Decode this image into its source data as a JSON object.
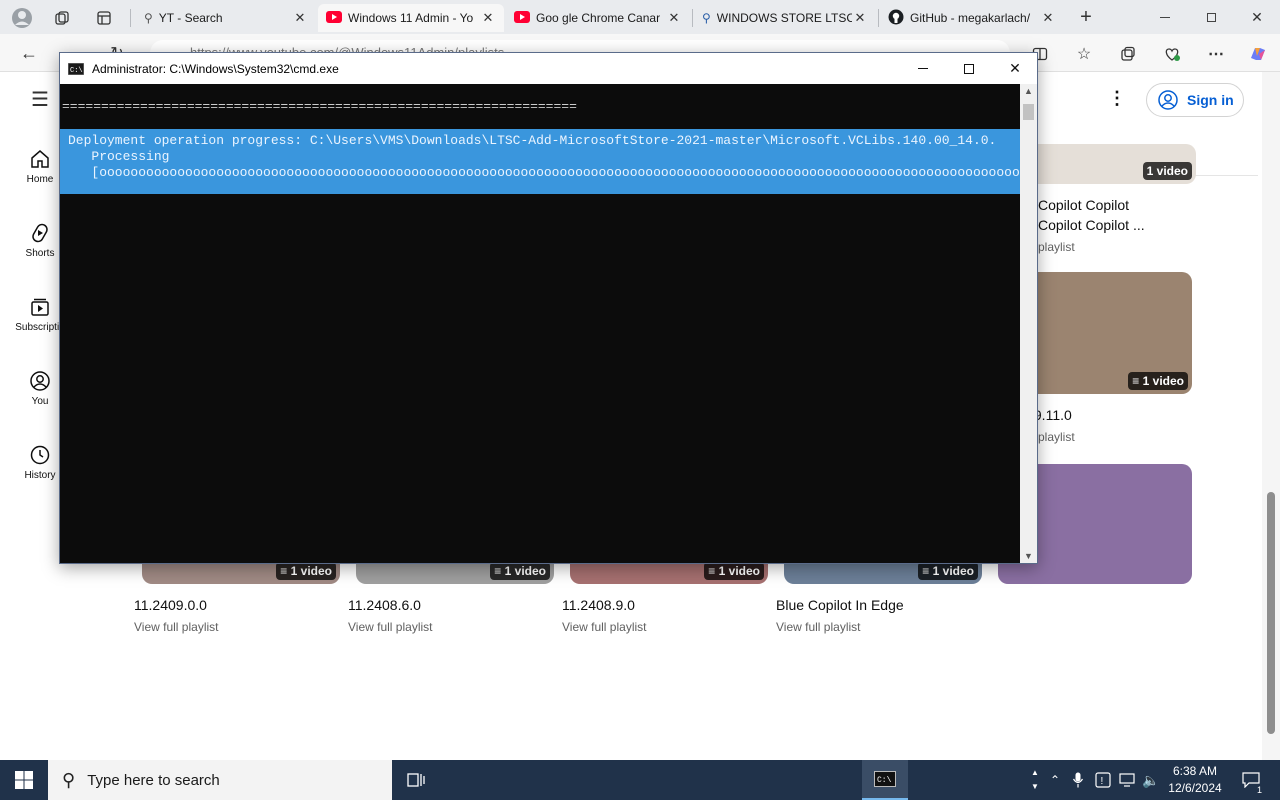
{
  "browser": {
    "tabs": [
      {
        "title": "YT - Search",
        "icon": "search-icon"
      },
      {
        "title": "Windows 11 Admin - Yo",
        "icon": "youtube-icon"
      },
      {
        "title": "Goo gle Chrome Canar",
        "icon": "youtube-icon"
      },
      {
        "title": "WINDOWS STORE LTSC",
        "icon": "search-icon"
      },
      {
        "title": "GitHub - megakarlach/",
        "icon": "github-icon"
      }
    ],
    "url": "https://www.youtube.com/@Windows11Admin/playlists"
  },
  "youtube": {
    "rail": [
      {
        "label": "Home",
        "icon": "home-icon"
      },
      {
        "label": "Shorts",
        "icon": "shorts-icon"
      },
      {
        "label": "Subscriptio",
        "icon": "subscriptions-icon"
      },
      {
        "label": "You",
        "icon": "you-icon"
      },
      {
        "label": "History",
        "icon": "history-icon"
      }
    ],
    "sign_in": "Sign in",
    "right_column": [
      {
        "title_line1": "Copilot Copilot",
        "title_line2": "Copilot Copilot ...",
        "link": "playlist",
        "badge": "1 video",
        "color": "#e5dfd8"
      },
      {
        "title": ".9.11.0",
        "link": "playlist",
        "badge": "1 video",
        "color": "#9b8470"
      },
      {
        "title": "",
        "link": "",
        "badge": "",
        "color": "#8a6fa2"
      }
    ],
    "bottom_row": [
      {
        "title": "11.2409.0.0",
        "link": "View full playlist",
        "badge": "1 video",
        "color": "#a08a84"
      },
      {
        "title": "11.2408.6.0",
        "link": "View full playlist",
        "badge": "1 video",
        "color": "#9f9f9f"
      },
      {
        "title": "11.2408.9.0",
        "link": "View full playlist",
        "badge": "1 video",
        "color": "#a67070"
      },
      {
        "title": "Blue Copilot In Edge",
        "link": "View full playlist",
        "badge": "1 video",
        "color": "#6c7f98"
      }
    ]
  },
  "cmd": {
    "title": "Administrator: C:\\Windows\\System32\\cmd.exe",
    "separator": "==================================================================",
    "progress_line1": "Deployment operation progress: C:\\Users\\VMS\\Downloads\\LTSC-Add-MicrosoftStore-2021-master\\Microsoft.VCLibs.140.00_14.0.",
    "progress_line2": "   Processing",
    "progress_line3": "   [oooooooooooooooooooooooooooooooooooooooooooooooooooooooooooooooooooooooooooooooooooooooooooooooooooooooooooooooooooooo  ]"
  },
  "taskbar": {
    "search_placeholder": "Type here to search",
    "time": "6:38 AM",
    "date": "12/6/2024",
    "notification_count": "1"
  }
}
